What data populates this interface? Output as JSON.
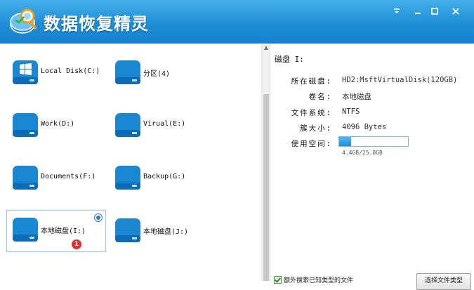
{
  "app": {
    "title": "数据恢复精灵"
  },
  "window_controls": [
    "minimize-icon",
    "restore-icon",
    "close-icon"
  ],
  "colors": {
    "title_bar": "#1f8fd6",
    "accent": "#1d8fd8",
    "badge": "#e03030"
  },
  "drives": [
    {
      "label": "Local Disk(C:)",
      "icon": "windows-drive-icon"
    },
    {
      "label": "分区(4)",
      "icon": "drive-icon"
    },
    {
      "label": "Work(D:)",
      "icon": "drive-icon"
    },
    {
      "label": "Virual(E:)",
      "icon": "drive-icon"
    },
    {
      "label": "Documents(F:)",
      "icon": "drive-icon"
    },
    {
      "label": "Backup(G:)",
      "icon": "drive-icon"
    },
    {
      "label": "本地磁盘(I:)",
      "icon": "drive-icon",
      "selected": true,
      "badge": "1"
    },
    {
      "label": "本地磁盘(J:)",
      "icon": "drive-icon"
    }
  ],
  "details": {
    "title": "磁盘 I:",
    "rows": [
      {
        "label": "所在磁盘:",
        "value": "HD2:MsftVirtualDisk(120GB)"
      },
      {
        "label": "卷名:",
        "value": "本地磁盘"
      },
      {
        "label": "文件系统:",
        "value": "NTFS"
      },
      {
        "label": "簇大小:",
        "value": "4096 Bytes"
      }
    ],
    "usage_label": "使用空间:",
    "usage_text": "4.4GB/25.0GB",
    "usage_fraction": 0.176
  },
  "footer": {
    "checkbox_label": "额外搜索已知类型的文件",
    "checkbox_checked": true,
    "button_label": "选择文件类型"
  }
}
